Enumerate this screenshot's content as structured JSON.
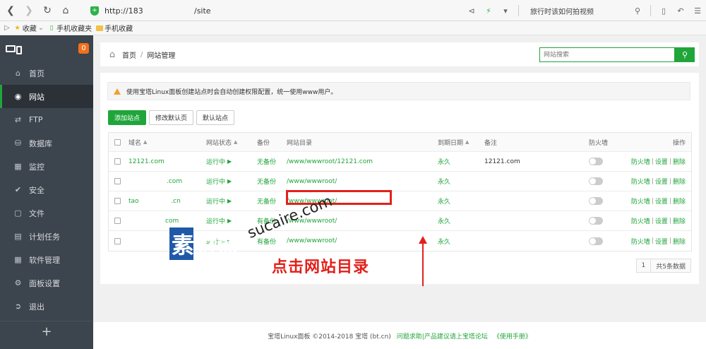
{
  "browser": {
    "url_host": "http://183",
    "url_path": "/site",
    "search_hint": "旅行时该如何拍视频",
    "bookmarks": [
      "收藏",
      "手机收藏夹",
      "手机收藏"
    ]
  },
  "sidebar": {
    "badge": "0",
    "items": [
      {
        "label": "首页",
        "icon": "home-icon"
      },
      {
        "label": "网站",
        "icon": "globe-icon",
        "active": true
      },
      {
        "label": "FTP",
        "icon": "ftp-icon"
      },
      {
        "label": "数据库",
        "icon": "database-icon"
      },
      {
        "label": "监控",
        "icon": "monitor-chart-icon"
      },
      {
        "label": "安全",
        "icon": "shield-check-icon"
      },
      {
        "label": "文件",
        "icon": "folder-icon"
      },
      {
        "label": "计划任务",
        "icon": "calendar-icon"
      },
      {
        "label": "软件管理",
        "icon": "apps-icon"
      },
      {
        "label": "面板设置",
        "icon": "gear-icon"
      },
      {
        "label": "退出",
        "icon": "logout-icon"
      }
    ],
    "add_label": "+"
  },
  "header": {
    "home": "首页",
    "sep": "/",
    "current": "网站管理",
    "search_placeholder": "网站搜索"
  },
  "notice": "使用宝塔Linux面板创建站点时会自动创建权限配置，统一使用www用户。",
  "buttons": {
    "add_site": "添加站点",
    "edit_default_page": "修改默认页",
    "default_site": "默认站点"
  },
  "table": {
    "columns": [
      "域名",
      "网站状态",
      "备份",
      "网站目录",
      "到期日期",
      "备注",
      "防火墙",
      "操作"
    ],
    "rows": [
      {
        "domain": "12121.com",
        "status": "运行中",
        "backup": "无备份",
        "dir": "/www/wwwroot/12121.com",
        "expire": "永久",
        "note": "12121.com"
      },
      {
        "domain": ".com",
        "status": "运行中",
        "backup": "无备份",
        "dir": "/www/wwwroot/",
        "expire": "永久",
        "note": ""
      },
      {
        "domain": "tao                .cn",
        "status": "运行中",
        "backup": "无备份",
        "dir": "/www/wwwroot/",
        "expire": "永久",
        "note": ""
      },
      {
        "domain": "com",
        "status": "运行中",
        "backup": "有备份",
        "dir": "/www/wwwroot/",
        "expire": "永久",
        "note": ""
      },
      {
        "domain": "",
        "status": "运行中",
        "backup": "有备份",
        "dir": "/www/wwwroot/",
        "expire": "永久",
        "note": ""
      }
    ],
    "ops": {
      "firewall": "防火墙",
      "settings": "设置",
      "delete": "删除",
      "bar": "|"
    }
  },
  "pager": {
    "page": "1",
    "total": "共5条数据"
  },
  "footer": {
    "copyright": "宝塔Linux面板 ©2014-2018 宝塔 (bt.cn)",
    "links": "问题求助|产品建议请上宝塔论坛",
    "manual": "《使用手册》"
  },
  "annotation": {
    "text": "点击网站目录"
  },
  "watermark": {
    "logo": "素材熱",
    "url": "sucaire.com"
  },
  "colors": {
    "accent": "#20a53a",
    "annotation": "#e3201b",
    "sidebar": "#3c444d"
  }
}
